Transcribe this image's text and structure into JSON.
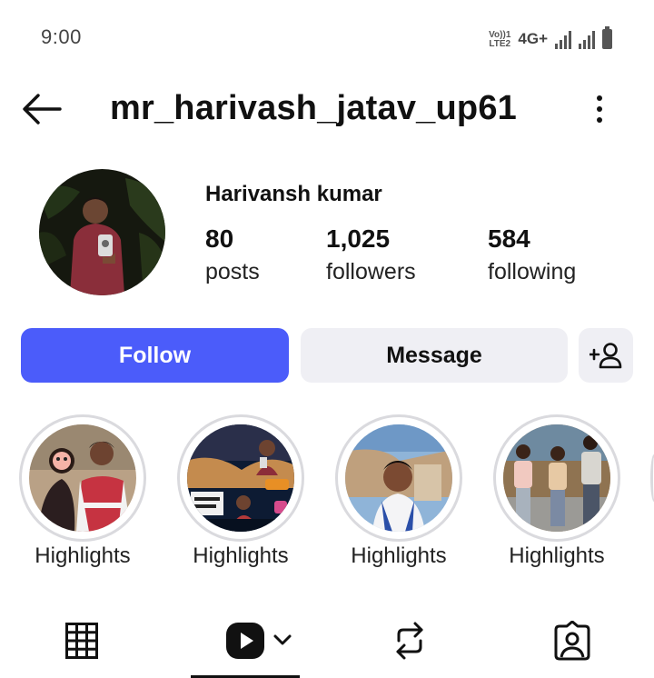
{
  "status_bar": {
    "time": "9:00",
    "volte_line1": "Vo))1",
    "volte_line2": "LTE2",
    "network": "4G+",
    "signal_icons": [
      "signal-icon",
      "signal-icon"
    ],
    "battery_icon": "battery-icon"
  },
  "header": {
    "back_icon": "arrow-left-icon",
    "username": "mr_harivash_jatav_up61",
    "more_icon": "more-vertical-icon"
  },
  "profile": {
    "full_name": "Harivansh kumar",
    "stats": [
      {
        "value": "80",
        "label": "posts"
      },
      {
        "value": "1,025",
        "label": "followers"
      },
      {
        "value": "584",
        "label": "following"
      }
    ]
  },
  "actions": {
    "follow": "Follow",
    "message": "Message",
    "add_user_icon": "add-user-icon"
  },
  "highlights": [
    {
      "label": "Highlights"
    },
    {
      "label": "Highlights"
    },
    {
      "label": "Highlights"
    },
    {
      "label": "Highlights"
    }
  ],
  "tabs": [
    {
      "icon": "grid-icon"
    },
    {
      "icon": "reels-icon",
      "selected": true
    },
    {
      "icon": "repost-icon"
    },
    {
      "icon": "tagged-icon"
    }
  ],
  "colors": {
    "accent": "#4b5cfa",
    "button_secondary": "#efeff4",
    "ring": "#dadade"
  }
}
